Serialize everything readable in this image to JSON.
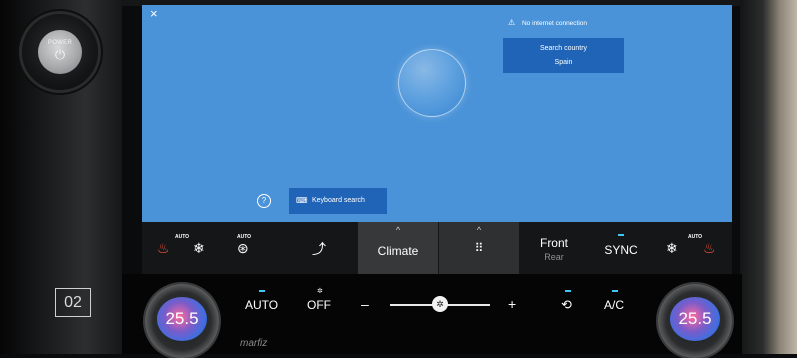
{
  "hardware": {
    "power_label": "POWER",
    "power_icon": "⏻",
    "panel_number": "02",
    "brand": "marfiz"
  },
  "screen": {
    "close_icon": "×",
    "status_icon": "⚠",
    "status_text": "No internet connection",
    "search_country_label": "Search country",
    "search_country_value": "Spain",
    "help_icon": "?",
    "keyboard_icon": "⌨",
    "keyboard_search_label": "Keyboard search"
  },
  "control_bar": {
    "left_seat_auto": "AUTO",
    "steering_auto": "AUTO",
    "climate_label": "Climate",
    "apps_icon": "⠿",
    "front_label": "Front",
    "rear_label": "Rear",
    "sync_label": "SYNC",
    "right_seat_auto": "AUTO",
    "chevron": "^"
  },
  "climate_controls": {
    "left_temp": "25.5",
    "right_temp": "25.5",
    "auto_label": "AUTO",
    "off_label": "OFF",
    "minus": "–",
    "plus": "+",
    "ac_label": "A/C",
    "fan_icon": "✲",
    "recirc_icon": "⟲",
    "fan_level_percent": 50
  },
  "colors": {
    "screen_bg": "#4a93d8",
    "button_bg": "#1f64b7",
    "indicator": "#3ec7f2"
  }
}
